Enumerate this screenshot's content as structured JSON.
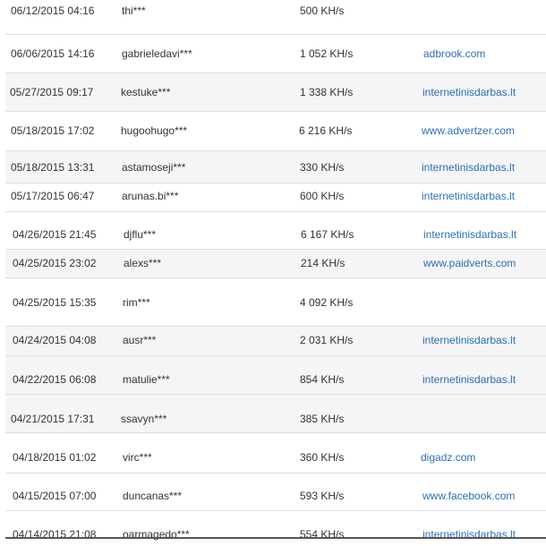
{
  "rows": [
    {
      "date": "06/12/2015 04:16",
      "user": "thi***",
      "speed": "500 KH/s",
      "site": ""
    },
    {
      "date": "06/06/2015 14:16",
      "user": "gabrieledavi***",
      "speed": "1 052 KH/s",
      "site": "adbrook.com"
    },
    {
      "date": "05/27/2015 09:17",
      "user": "kestuke***",
      "speed": "1 338 KH/s",
      "site": "internetinisdarbas.lt"
    },
    {
      "date": "05/18/2015 17:02",
      "user": "hugoohugo***",
      "speed": "6 216 KH/s",
      "site": "www.advertzer.com"
    },
    {
      "date": "05/18/2015 13:31",
      "user": "astamoseji***",
      "speed": "330 KH/s",
      "site": "internetinisdarbas.lt"
    },
    {
      "date": "05/17/2015 06:47",
      "user": "arunas.bi***",
      "speed": "600 KH/s",
      "site": "internetinisdarbas.lt"
    },
    {
      "date": "04/26/2015 21:45",
      "user": "djflu***",
      "speed": "6 167 KH/s",
      "site": "internetinisdarbas.lt"
    },
    {
      "date": "04/25/2015 23:02",
      "user": "alexs***",
      "speed": "214 KH/s",
      "site": "www.paidverts.com"
    },
    {
      "date": "04/25/2015 15:35",
      "user": "rim***",
      "speed": "4 092 KH/s",
      "site": ""
    },
    {
      "date": "04/24/2015 04:08",
      "user": "ausr***",
      "speed": "2 031 KH/s",
      "site": "internetinisdarbas.lt"
    },
    {
      "date": "04/22/2015 06:08",
      "user": "matulie***",
      "speed": "854 KH/s",
      "site": "internetinisdarbas.lt"
    },
    {
      "date": "04/21/2015 17:31",
      "user": "ssavyn***",
      "speed": "385 KH/s",
      "site": ""
    },
    {
      "date": "04/18/2015 01:02",
      "user": "virc***",
      "speed": "360 KH/s",
      "site": "digadz.com"
    },
    {
      "date": "04/15/2015 07:00",
      "user": "duncanas***",
      "speed": "593 KH/s",
      "site": "www.facebook.com"
    },
    {
      "date": "04/14/2015 21:08",
      "user": "oarmagedo***",
      "speed": "554 KH/s",
      "site": "internetinisdarbas.lt"
    }
  ]
}
